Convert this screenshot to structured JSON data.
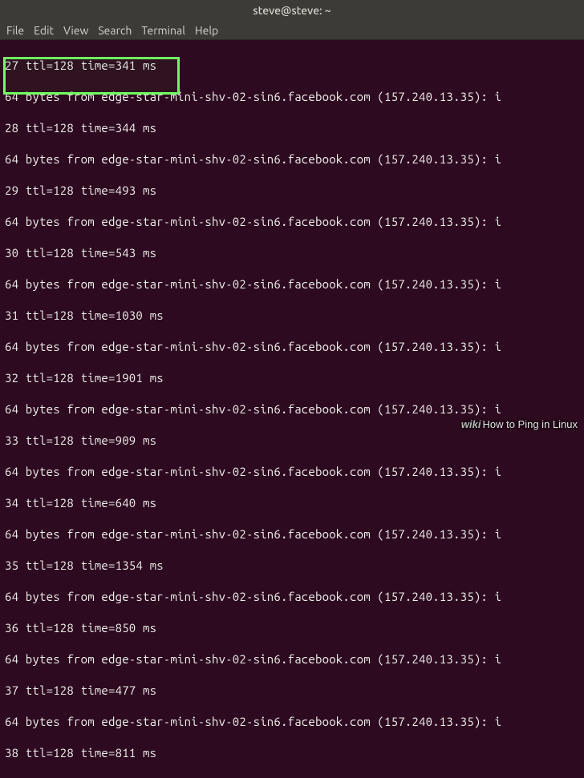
{
  "title": "steve@steve: ~",
  "menu": {
    "file": "File",
    "edit": "Edit",
    "view": "View",
    "search": "Search",
    "terminal": "Terminal",
    "help": "Help"
  },
  "lines": [
    "27 ttl=128 time=341 ms",
    "64 bytes from edge-star-mini-shv-02-sin6.facebook.com (157.240.13.35): i",
    "28 ttl=128 time=344 ms",
    "64 bytes from edge-star-mini-shv-02-sin6.facebook.com (157.240.13.35): i",
    "29 ttl=128 time=493 ms",
    "64 bytes from edge-star-mini-shv-02-sin6.facebook.com (157.240.13.35): i",
    "30 ttl=128 time=543 ms",
    "64 bytes from edge-star-mini-shv-02-sin6.facebook.com (157.240.13.35): i",
    "31 ttl=128 time=1030 ms",
    "64 bytes from edge-star-mini-shv-02-sin6.facebook.com (157.240.13.35): i",
    "32 ttl=128 time=1901 ms",
    "64 bytes from edge-star-mini-shv-02-sin6.facebook.com (157.240.13.35): i",
    "33 ttl=128 time=909 ms",
    "64 bytes from edge-star-mini-shv-02-sin6.facebook.com (157.240.13.35): i",
    "34 ttl=128 time=640 ms",
    "64 bytes from edge-star-mini-shv-02-sin6.facebook.com (157.240.13.35): i",
    "35 ttl=128 time=1354 ms",
    "64 bytes from edge-star-mini-shv-02-sin6.facebook.com (157.240.13.35): i",
    "36 ttl=128 time=850 ms",
    "64 bytes from edge-star-mini-shv-02-sin6.facebook.com (157.240.13.35): i",
    "37 ttl=128 time=477 ms",
    "64 bytes from edge-star-mini-shv-02-sin6.facebook.com (157.240.13.35): i",
    "38 ttl=128 time=811 ms"
  ],
  "watermark": {
    "brand": "wiki",
    "text": "How to Ping in Linux"
  }
}
